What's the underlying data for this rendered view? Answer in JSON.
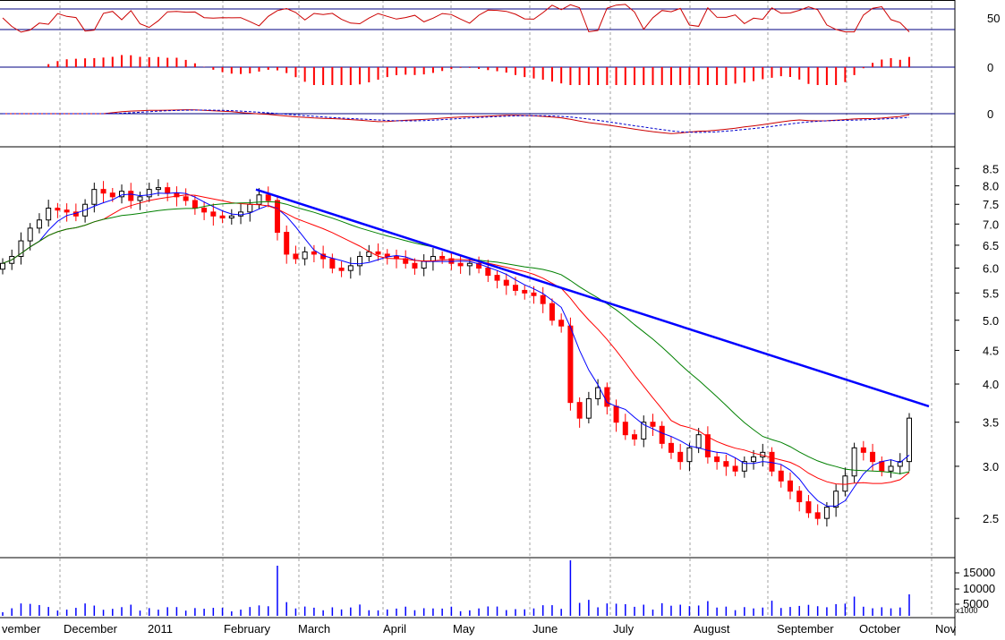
{
  "chart_data": {
    "type": "candlestick",
    "scale": "log",
    "grid": true,
    "colors": {
      "up_candle": "#000000",
      "down_candle": "#ff0000",
      "ma_fast": "#0000ff",
      "ma_mid": "#ff0000",
      "ma_slow": "#008000",
      "trendline": "#0000ff",
      "rsi_line": "#cc0000",
      "osc_bars": "#ff0000",
      "macd_line": "#cc0000",
      "macd_signal": "#0000cc",
      "volume_bars": "#0000ff",
      "grid": "#a0a0a0"
    },
    "months": [
      {
        "label": "vember"
      },
      {
        "label": "December"
      },
      {
        "label": "2011"
      },
      {
        "label": "February"
      },
      {
        "label": "March"
      },
      {
        "label": "April"
      },
      {
        "label": "May"
      },
      {
        "label": "June"
      },
      {
        "label": "July"
      },
      {
        "label": "August"
      },
      {
        "label": "September"
      },
      {
        "label": "October"
      },
      {
        "label": "Nov"
      }
    ],
    "price_axis": {
      "range": [
        2.2,
        9.0
      ],
      "ticks": [
        "8.5",
        "8.0",
        "7.5",
        "7.0",
        "6.5",
        "6.0",
        "5.5",
        "5.0",
        "4.5",
        "4.0",
        "3.5",
        "3.0",
        "2.5"
      ]
    },
    "indicator_axes": {
      "rsi_tick": "50",
      "osc_tick": "0",
      "macd_tick": "0"
    },
    "volume_axis": {
      "ticks": [
        "15000",
        "10000",
        "5000"
      ],
      "multiplier": "x1000"
    },
    "close_series": [
      6.1,
      6.25,
      6.6,
      6.9,
      7.1,
      7.4,
      7.35,
      7.3,
      7.2,
      7.5,
      7.9,
      7.8,
      7.7,
      7.85,
      7.6,
      7.7,
      7.9,
      7.95,
      7.8,
      7.7,
      7.6,
      7.4,
      7.3,
      7.2,
      7.15,
      7.2,
      7.3,
      7.5,
      7.75,
      7.6,
      6.8,
      6.3,
      6.2,
      6.35,
      6.3,
      6.2,
      6.0,
      5.95,
      6.05,
      6.25,
      6.35,
      6.3,
      6.25,
      6.2,
      6.1,
      6.0,
      6.15,
      6.25,
      6.2,
      6.1,
      6.05,
      6.1,
      6.0,
      5.85,
      5.75,
      5.65,
      5.55,
      5.5,
      5.45,
      5.3,
      5.0,
      4.9,
      3.75,
      3.55,
      3.8,
      3.95,
      3.7,
      3.5,
      3.35,
      3.3,
      3.5,
      3.45,
      3.25,
      3.15,
      3.05,
      3.2,
      3.35,
      3.1,
      3.05,
      3.0,
      2.95,
      3.05,
      3.1,
      3.15,
      2.95,
      2.85,
      2.75,
      2.65,
      2.55,
      2.5,
      2.6,
      2.75,
      2.9,
      3.2,
      3.15,
      3.05,
      2.95,
      3.0,
      3.05,
      3.55
    ],
    "trendline": {
      "from": {
        "month": "February",
        "price": 7.9
      },
      "to": {
        "month": "November",
        "price": 3.7
      }
    }
  }
}
